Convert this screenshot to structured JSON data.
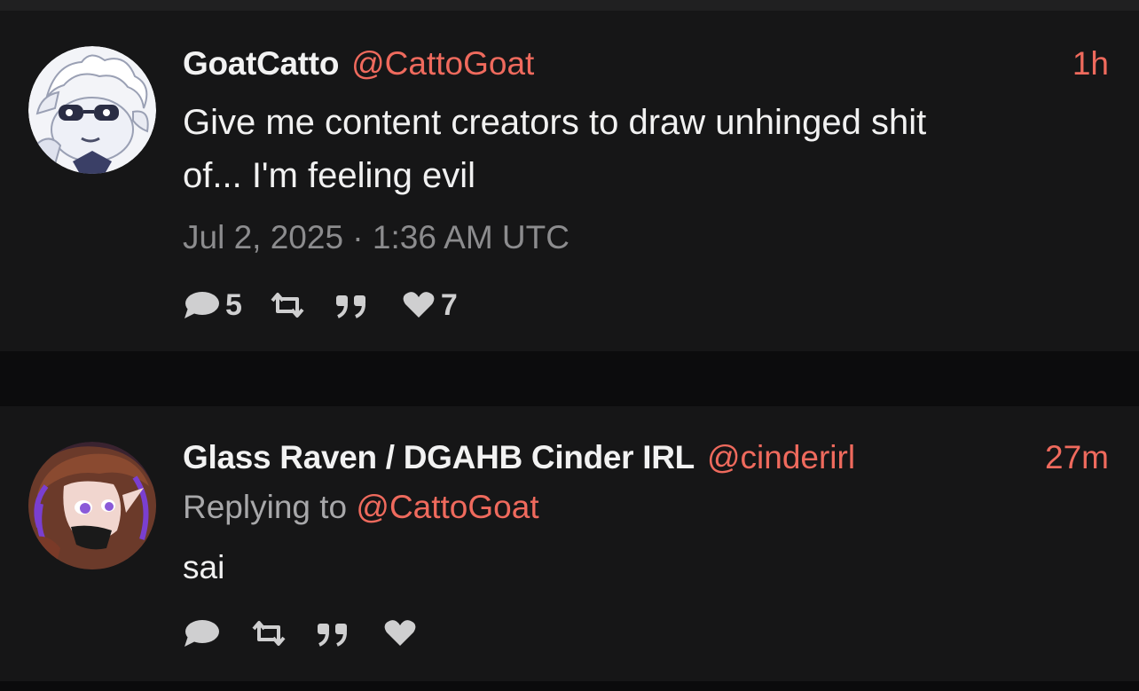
{
  "tweets": [
    {
      "name": "GoatCatto",
      "handle": "@CattoGoat",
      "time": "1h",
      "text_line1": "Give me content creators to draw unhinged shit",
      "text_line2": "of... I'm feeling evil",
      "date": "Jul 2, 2025 · 1:36 AM UTC",
      "replies": "5",
      "likes": "7"
    },
    {
      "name": "Glass Raven / DGAHB Cinder IRL",
      "handle": "@cinderirl",
      "time": "27m",
      "replying_prefix": "Replying to ",
      "replying_handle": "@CattoGoat",
      "text": "sai"
    }
  ],
  "icons": [
    "comment-icon",
    "retweet-icon",
    "quote-icon",
    "heart-icon"
  ],
  "colors": {
    "accent": "#ef6a5d",
    "tweet_background": "#161617",
    "page_background": "#0b0b0c",
    "text": "#f1f1f1",
    "muted": "#8c8c8e"
  }
}
